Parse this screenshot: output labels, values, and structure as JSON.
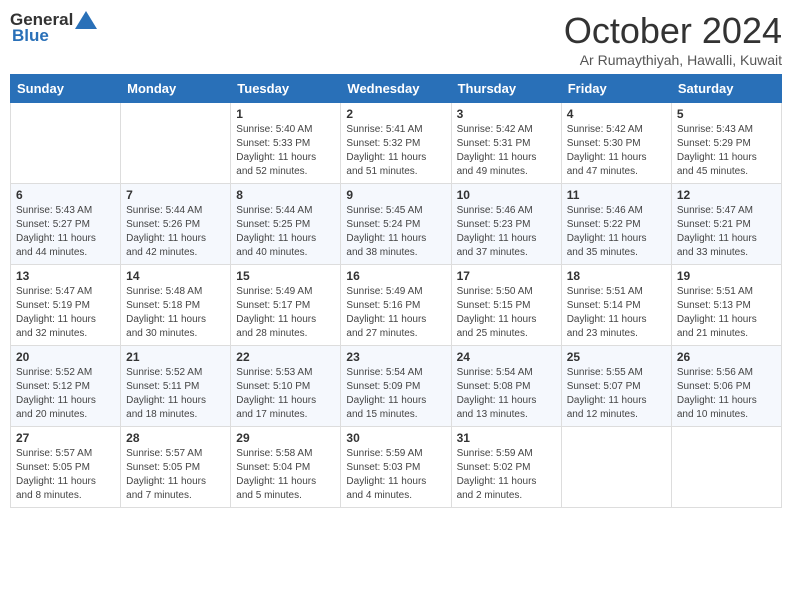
{
  "header": {
    "logo_general": "General",
    "logo_blue": "Blue",
    "month_title": "October 2024",
    "location": "Ar Rumaythiyah, Hawalli, Kuwait"
  },
  "days_of_week": [
    "Sunday",
    "Monday",
    "Tuesday",
    "Wednesday",
    "Thursday",
    "Friday",
    "Saturday"
  ],
  "weeks": [
    [
      {
        "day": "",
        "info": ""
      },
      {
        "day": "",
        "info": ""
      },
      {
        "day": "1",
        "info": "Sunrise: 5:40 AM\nSunset: 5:33 PM\nDaylight: 11 hours and 52 minutes."
      },
      {
        "day": "2",
        "info": "Sunrise: 5:41 AM\nSunset: 5:32 PM\nDaylight: 11 hours and 51 minutes."
      },
      {
        "day": "3",
        "info": "Sunrise: 5:42 AM\nSunset: 5:31 PM\nDaylight: 11 hours and 49 minutes."
      },
      {
        "day": "4",
        "info": "Sunrise: 5:42 AM\nSunset: 5:30 PM\nDaylight: 11 hours and 47 minutes."
      },
      {
        "day": "5",
        "info": "Sunrise: 5:43 AM\nSunset: 5:29 PM\nDaylight: 11 hours and 45 minutes."
      }
    ],
    [
      {
        "day": "6",
        "info": "Sunrise: 5:43 AM\nSunset: 5:27 PM\nDaylight: 11 hours and 44 minutes."
      },
      {
        "day": "7",
        "info": "Sunrise: 5:44 AM\nSunset: 5:26 PM\nDaylight: 11 hours and 42 minutes."
      },
      {
        "day": "8",
        "info": "Sunrise: 5:44 AM\nSunset: 5:25 PM\nDaylight: 11 hours and 40 minutes."
      },
      {
        "day": "9",
        "info": "Sunrise: 5:45 AM\nSunset: 5:24 PM\nDaylight: 11 hours and 38 minutes."
      },
      {
        "day": "10",
        "info": "Sunrise: 5:46 AM\nSunset: 5:23 PM\nDaylight: 11 hours and 37 minutes."
      },
      {
        "day": "11",
        "info": "Sunrise: 5:46 AM\nSunset: 5:22 PM\nDaylight: 11 hours and 35 minutes."
      },
      {
        "day": "12",
        "info": "Sunrise: 5:47 AM\nSunset: 5:21 PM\nDaylight: 11 hours and 33 minutes."
      }
    ],
    [
      {
        "day": "13",
        "info": "Sunrise: 5:47 AM\nSunset: 5:19 PM\nDaylight: 11 hours and 32 minutes."
      },
      {
        "day": "14",
        "info": "Sunrise: 5:48 AM\nSunset: 5:18 PM\nDaylight: 11 hours and 30 minutes."
      },
      {
        "day": "15",
        "info": "Sunrise: 5:49 AM\nSunset: 5:17 PM\nDaylight: 11 hours and 28 minutes."
      },
      {
        "day": "16",
        "info": "Sunrise: 5:49 AM\nSunset: 5:16 PM\nDaylight: 11 hours and 27 minutes."
      },
      {
        "day": "17",
        "info": "Sunrise: 5:50 AM\nSunset: 5:15 PM\nDaylight: 11 hours and 25 minutes."
      },
      {
        "day": "18",
        "info": "Sunrise: 5:51 AM\nSunset: 5:14 PM\nDaylight: 11 hours and 23 minutes."
      },
      {
        "day": "19",
        "info": "Sunrise: 5:51 AM\nSunset: 5:13 PM\nDaylight: 11 hours and 21 minutes."
      }
    ],
    [
      {
        "day": "20",
        "info": "Sunrise: 5:52 AM\nSunset: 5:12 PM\nDaylight: 11 hours and 20 minutes."
      },
      {
        "day": "21",
        "info": "Sunrise: 5:52 AM\nSunset: 5:11 PM\nDaylight: 11 hours and 18 minutes."
      },
      {
        "day": "22",
        "info": "Sunrise: 5:53 AM\nSunset: 5:10 PM\nDaylight: 11 hours and 17 minutes."
      },
      {
        "day": "23",
        "info": "Sunrise: 5:54 AM\nSunset: 5:09 PM\nDaylight: 11 hours and 15 minutes."
      },
      {
        "day": "24",
        "info": "Sunrise: 5:54 AM\nSunset: 5:08 PM\nDaylight: 11 hours and 13 minutes."
      },
      {
        "day": "25",
        "info": "Sunrise: 5:55 AM\nSunset: 5:07 PM\nDaylight: 11 hours and 12 minutes."
      },
      {
        "day": "26",
        "info": "Sunrise: 5:56 AM\nSunset: 5:06 PM\nDaylight: 11 hours and 10 minutes."
      }
    ],
    [
      {
        "day": "27",
        "info": "Sunrise: 5:57 AM\nSunset: 5:05 PM\nDaylight: 11 hours and 8 minutes."
      },
      {
        "day": "28",
        "info": "Sunrise: 5:57 AM\nSunset: 5:05 PM\nDaylight: 11 hours and 7 minutes."
      },
      {
        "day": "29",
        "info": "Sunrise: 5:58 AM\nSunset: 5:04 PM\nDaylight: 11 hours and 5 minutes."
      },
      {
        "day": "30",
        "info": "Sunrise: 5:59 AM\nSunset: 5:03 PM\nDaylight: 11 hours and 4 minutes."
      },
      {
        "day": "31",
        "info": "Sunrise: 5:59 AM\nSunset: 5:02 PM\nDaylight: 11 hours and 2 minutes."
      },
      {
        "day": "",
        "info": ""
      },
      {
        "day": "",
        "info": ""
      }
    ]
  ]
}
